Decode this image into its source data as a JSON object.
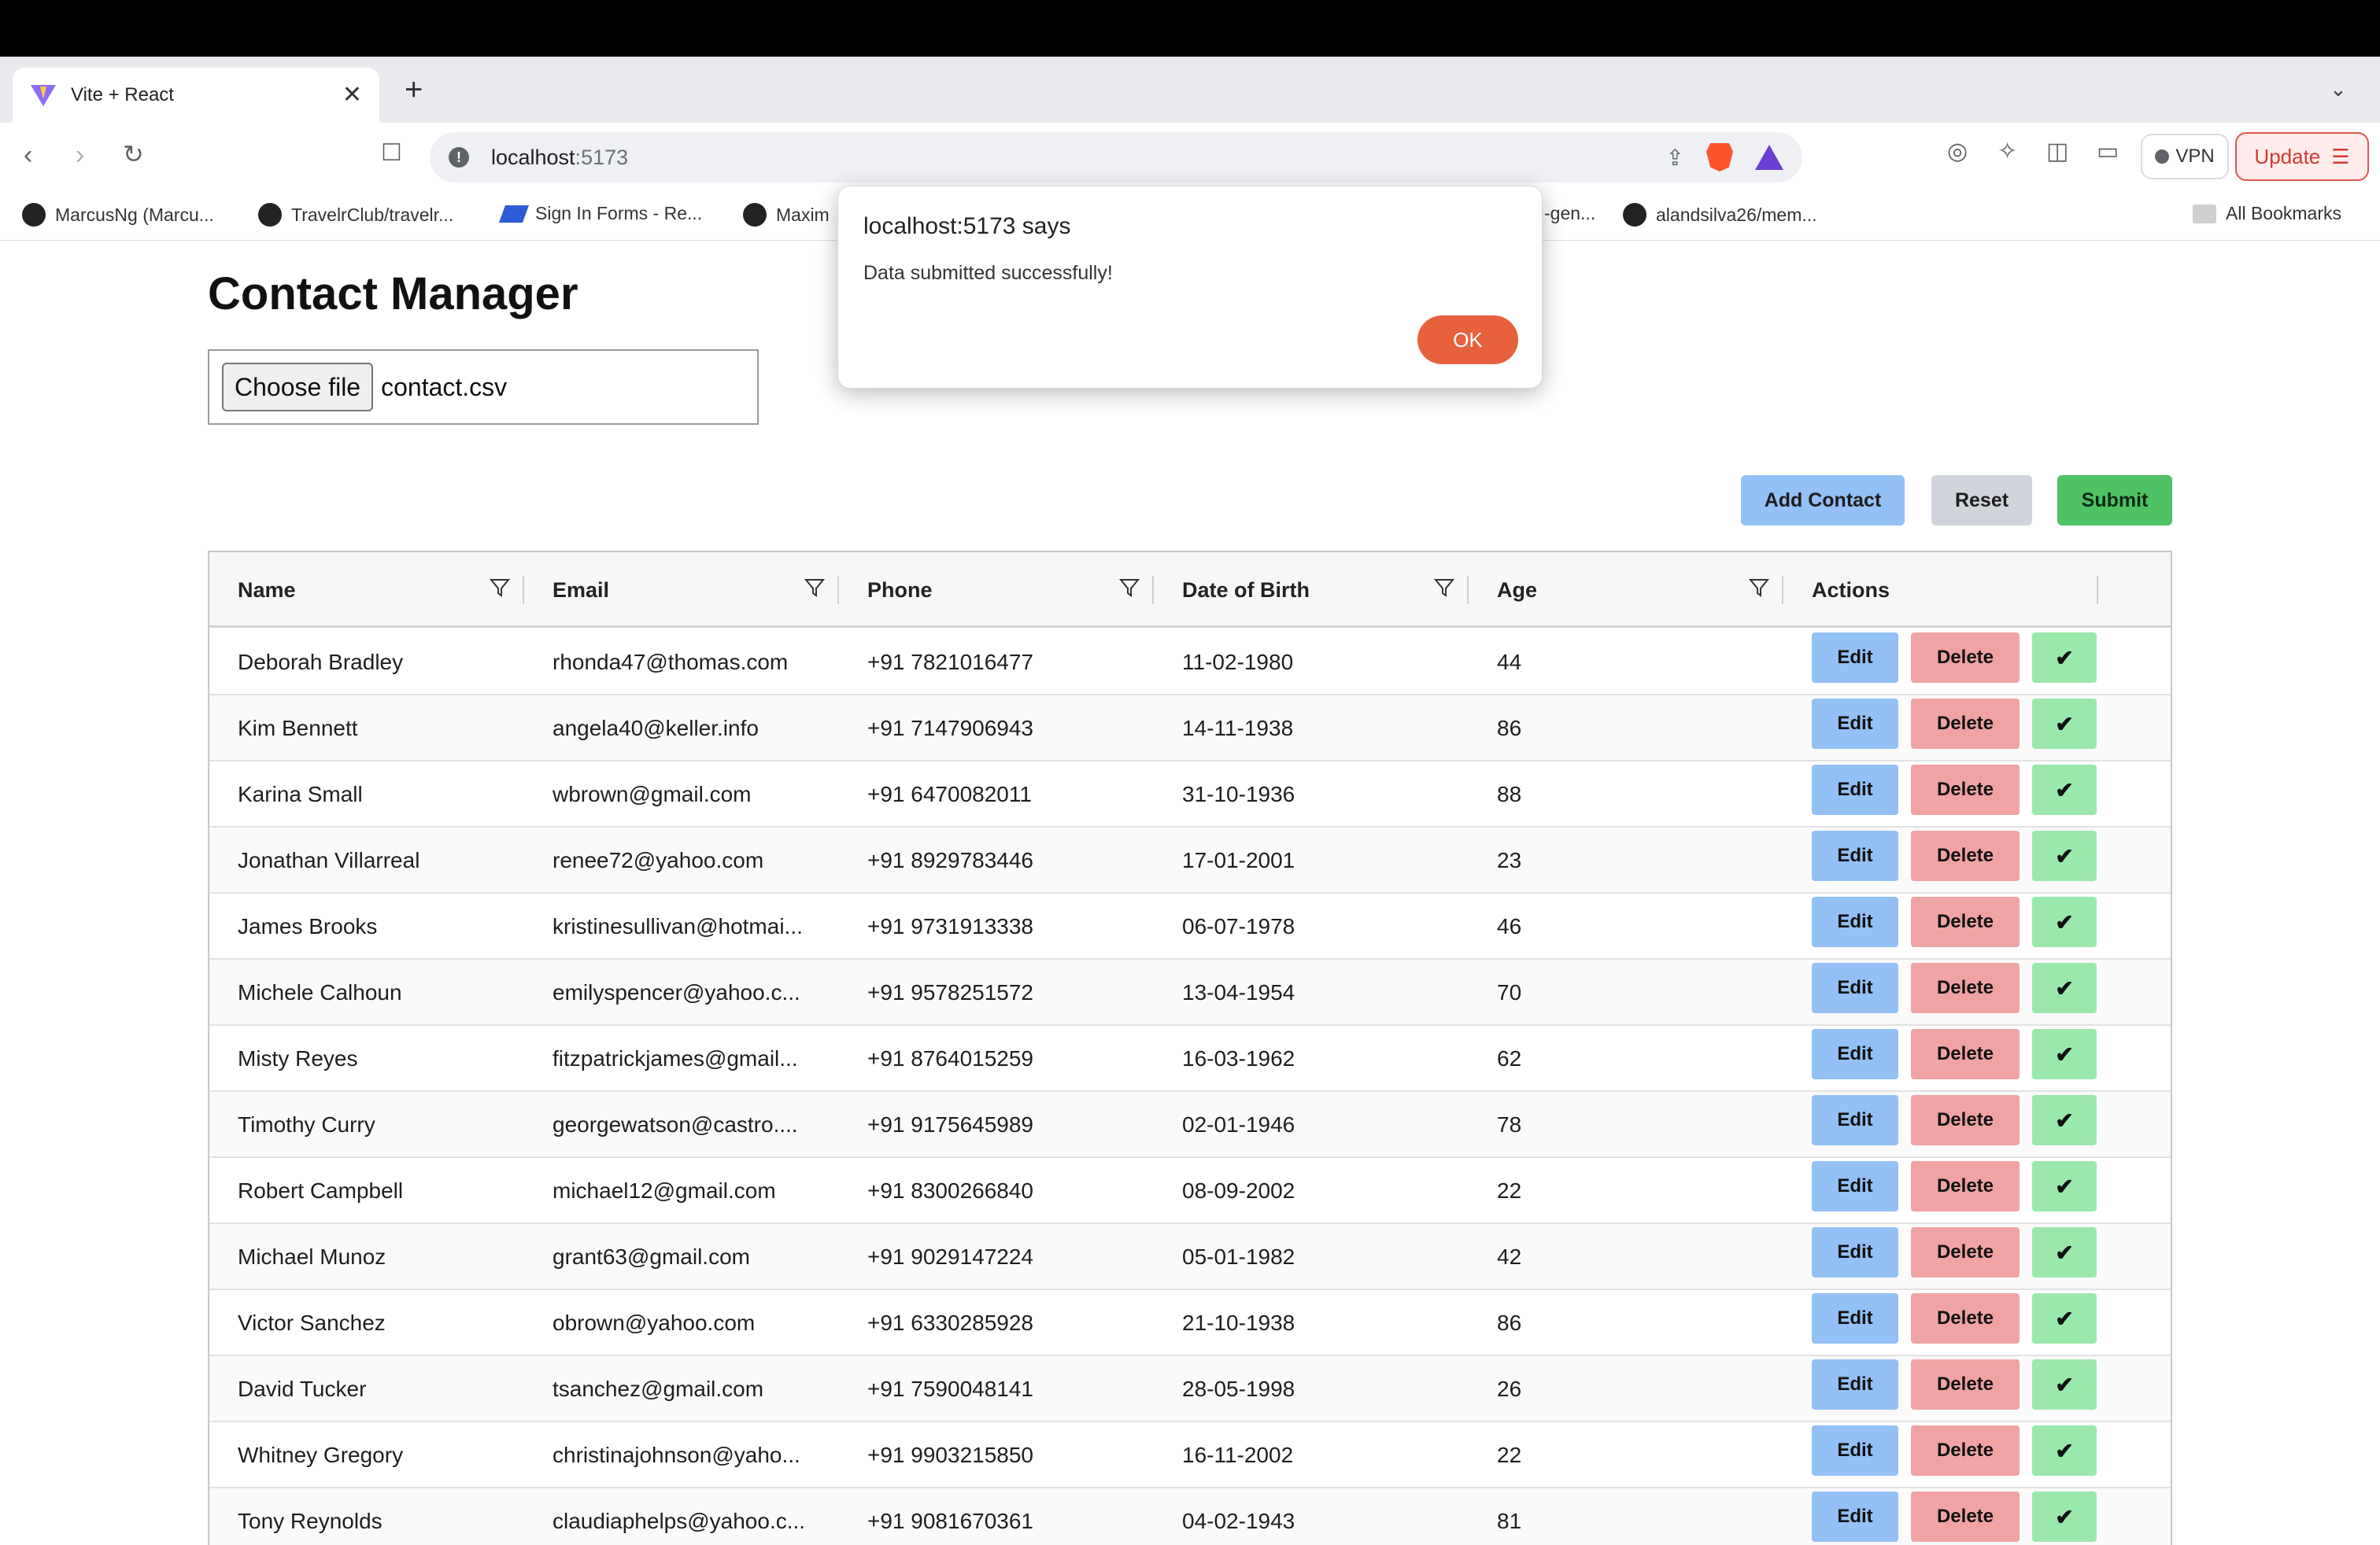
{
  "browser": {
    "tab_title": "Vite + React",
    "tab_close": "✕",
    "new_tab": "+",
    "url_host": "localhost",
    "url_port": ":5173",
    "vpn_label": "VPN",
    "update_label": "Update",
    "bookmarks": [
      {
        "label": "MarcusNg (Marcu...",
        "icon": "github-icon"
      },
      {
        "label": "TravelrClub/travelr...",
        "icon": "github-icon"
      },
      {
        "label": "Sign In Forms - Re...",
        "icon": "bookmark-blue-icon"
      },
      {
        "label": "Maxim",
        "icon": "github-icon"
      },
      {
        "label": "-gen...",
        "icon": "none"
      },
      {
        "label": "alandsilva26/mem...",
        "icon": "github-icon"
      }
    ],
    "all_bookmarks": "All Bookmarks"
  },
  "page": {
    "title": "Contact Manager",
    "file_button": "Choose file",
    "file_name": "contact.csv",
    "buttons": {
      "add": "Add Contact",
      "reset": "Reset",
      "submit": "Submit"
    }
  },
  "table": {
    "columns": [
      "Name",
      "Email",
      "Phone",
      "Date of Birth",
      "Age",
      "Actions"
    ],
    "action_labels": {
      "edit": "Edit",
      "delete": "Delete",
      "confirm": "✔"
    },
    "rows": [
      [
        "Deborah Bradley",
        "rhonda47@thomas.com",
        "+91 7821016477",
        "11-02-1980",
        "44"
      ],
      [
        "Kim Bennett",
        "angela40@keller.info",
        "+91 7147906943",
        "14-11-1938",
        "86"
      ],
      [
        "Karina Small",
        "wbrown@gmail.com",
        "+91 6470082011",
        "31-10-1936",
        "88"
      ],
      [
        "Jonathan Villarreal",
        "renee72@yahoo.com",
        "+91 8929783446",
        "17-01-2001",
        "23"
      ],
      [
        "James Brooks",
        "kristinesullivan@hotmai...",
        "+91 9731913338",
        "06-07-1978",
        "46"
      ],
      [
        "Michele Calhoun",
        "emilyspencer@yahoo.c...",
        "+91 9578251572",
        "13-04-1954",
        "70"
      ],
      [
        "Misty Reyes",
        "fitzpatrickjames@gmail...",
        "+91 8764015259",
        "16-03-1962",
        "62"
      ],
      [
        "Timothy Curry",
        "georgewatson@castro....",
        "+91 9175645989",
        "02-01-1946",
        "78"
      ],
      [
        "Robert Campbell",
        "michael12@gmail.com",
        "+91 8300266840",
        "08-09-2002",
        "22"
      ],
      [
        "Michael Munoz",
        "grant63@gmail.com",
        "+91 9029147224",
        "05-01-1982",
        "42"
      ],
      [
        "Victor Sanchez",
        "obrown@yahoo.com",
        "+91 6330285928",
        "21-10-1938",
        "86"
      ],
      [
        "David Tucker",
        "tsanchez@gmail.com",
        "+91 7590048141",
        "28-05-1998",
        "26"
      ],
      [
        "Whitney Gregory",
        "christinajohnson@yaho...",
        "+91 9903215850",
        "16-11-2002",
        "22"
      ],
      [
        "Tony Reynolds",
        "claudiaphelps@yahoo.c...",
        "+91 9081670361",
        "04-02-1943",
        "81"
      ]
    ]
  },
  "dialog": {
    "title": "localhost:5173 says",
    "message": "Data submitted successfully!",
    "ok": "OK"
  },
  "colors": {
    "edit": "#93c0f5",
    "delete": "#f0a3a3",
    "confirm": "#9be8ad",
    "submit": "#4fc266",
    "ok": "#e8613d"
  }
}
